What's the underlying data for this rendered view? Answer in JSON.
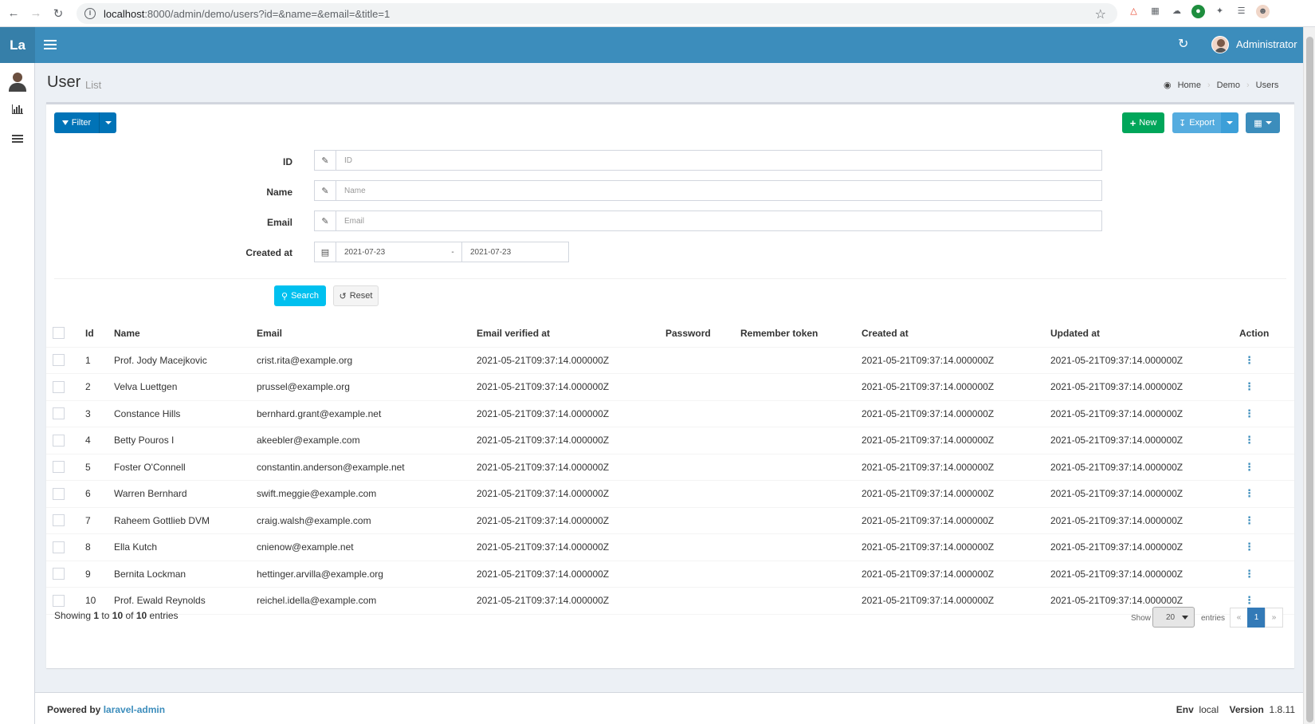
{
  "browser": {
    "url_host": "localhost",
    "url_rest": ":8000/admin/demo/users?id=&name=&email=&title=1"
  },
  "header": {
    "logo": "La",
    "user_name": "Administrator"
  },
  "page": {
    "title": "User",
    "subtitle": "List",
    "breadcrumb": [
      "Home",
      "Demo",
      "Users"
    ]
  },
  "toolbar": {
    "filter_label": "Filter",
    "new_label": "New",
    "export_label": "Export"
  },
  "filter": {
    "id_label": "ID",
    "id_placeholder": "ID",
    "name_label": "Name",
    "name_placeholder": "Name",
    "email_label": "Email",
    "email_placeholder": "Email",
    "created_label": "Created at",
    "created_from": "2021-07-23",
    "created_dash": "-",
    "created_to": "2021-07-23",
    "search_label": "Search",
    "reset_label": "Reset"
  },
  "table": {
    "headers": [
      "Id",
      "Name",
      "Email",
      "Email verified at",
      "Password",
      "Remember token",
      "Created at",
      "Updated at",
      "Action"
    ],
    "rows": [
      {
        "id": "1",
        "name": "Prof. Jody Macejkovic",
        "email": "crist.rita@example.org",
        "verified": "2021-05-21T09:37:14.000000Z",
        "created": "2021-05-21T09:37:14.000000Z",
        "updated": "2021-05-21T09:37:14.000000Z"
      },
      {
        "id": "2",
        "name": "Velva Luettgen",
        "email": "prussel@example.org",
        "verified": "2021-05-21T09:37:14.000000Z",
        "created": "2021-05-21T09:37:14.000000Z",
        "updated": "2021-05-21T09:37:14.000000Z"
      },
      {
        "id": "3",
        "name": "Constance Hills",
        "email": "bernhard.grant@example.net",
        "verified": "2021-05-21T09:37:14.000000Z",
        "created": "2021-05-21T09:37:14.000000Z",
        "updated": "2021-05-21T09:37:14.000000Z"
      },
      {
        "id": "4",
        "name": "Betty Pouros I",
        "email": "akeebler@example.com",
        "verified": "2021-05-21T09:37:14.000000Z",
        "created": "2021-05-21T09:37:14.000000Z",
        "updated": "2021-05-21T09:37:14.000000Z"
      },
      {
        "id": "5",
        "name": "Foster O'Connell",
        "email": "constantin.anderson@example.net",
        "verified": "2021-05-21T09:37:14.000000Z",
        "created": "2021-05-21T09:37:14.000000Z",
        "updated": "2021-05-21T09:37:14.000000Z"
      },
      {
        "id": "6",
        "name": "Warren Bernhard",
        "email": "swift.meggie@example.com",
        "verified": "2021-05-21T09:37:14.000000Z",
        "created": "2021-05-21T09:37:14.000000Z",
        "updated": "2021-05-21T09:37:14.000000Z"
      },
      {
        "id": "7",
        "name": "Raheem Gottlieb DVM",
        "email": "craig.walsh@example.com",
        "verified": "2021-05-21T09:37:14.000000Z",
        "created": "2021-05-21T09:37:14.000000Z",
        "updated": "2021-05-21T09:37:14.000000Z"
      },
      {
        "id": "8",
        "name": "Ella Kutch",
        "email": "cnienow@example.net",
        "verified": "2021-05-21T09:37:14.000000Z",
        "created": "2021-05-21T09:37:14.000000Z",
        "updated": "2021-05-21T09:37:14.000000Z"
      },
      {
        "id": "9",
        "name": "Bernita Lockman",
        "email": "hettinger.arvilla@example.org",
        "verified": "2021-05-21T09:37:14.000000Z",
        "created": "2021-05-21T09:37:14.000000Z",
        "updated": "2021-05-21T09:37:14.000000Z"
      },
      {
        "id": "10",
        "name": "Prof. Ewald Reynolds",
        "email": "reichel.idella@example.com",
        "verified": "2021-05-21T09:37:14.000000Z",
        "created": "2021-05-21T09:37:14.000000Z",
        "updated": "2021-05-21T09:37:14.000000Z"
      }
    ]
  },
  "pagination": {
    "showing_prefix": "Showing",
    "from": "1",
    "to_word": "to",
    "to": "10",
    "of_word": "of",
    "total": "10",
    "suffix": "entries",
    "show_label": "Show",
    "per_page": "20",
    "entries_label": "entries",
    "prev": "«",
    "current_page": "1",
    "next": "»"
  },
  "footer": {
    "powered_by": "Powered by",
    "link_text": "laravel-admin",
    "env_label": "Env",
    "env_value": "local",
    "version_label": "Version",
    "version_value": "1.8.11"
  },
  "colors": {
    "header_bg": "#3c8dbc",
    "filter_btn": "#0073b7",
    "new_btn": "#00a65a",
    "export_btn": "#55acdf",
    "search_btn": "#00c0ef"
  }
}
